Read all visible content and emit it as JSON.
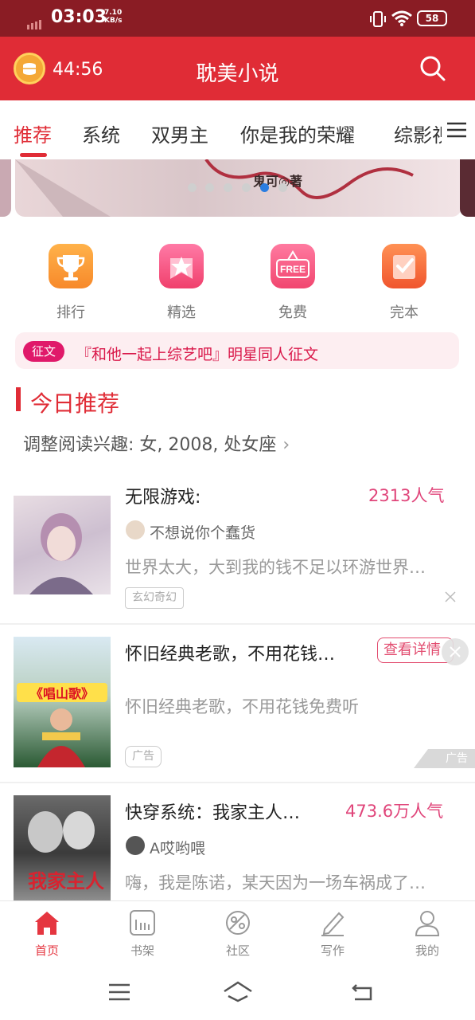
{
  "status_bar": {
    "time": "03:03",
    "speed_value": "7.10",
    "speed_unit": "KB/s",
    "battery": "58"
  },
  "header": {
    "timer": "44:56",
    "title": "耽美小说"
  },
  "tabs": [
    {
      "label": "推荐",
      "active": true
    },
    {
      "label": "系统"
    },
    {
      "label": "双男主"
    },
    {
      "label": "你是我的荣耀"
    },
    {
      "label": "综影视"
    }
  ],
  "banner": {
    "author_text": "鬼可◎著",
    "dots": 6,
    "active_dot": 4
  },
  "quick_links": [
    {
      "label": "排行",
      "icon": "trophy-icon",
      "color": "#f9982f"
    },
    {
      "label": "精选",
      "icon": "star-icon",
      "color": "#f55483"
    },
    {
      "label": "免费",
      "icon": "free-icon",
      "color": "#f4577f",
      "icon_text": "FREE"
    },
    {
      "label": "完本",
      "icon": "check-book-icon",
      "color": "#f76b3d"
    }
  ],
  "notice": {
    "tag": "征文",
    "text": "『和他一起上综艺吧』明星同人征文"
  },
  "section": {
    "title": "今日推荐",
    "interest": "调整阅读兴趣: 女, 2008, 处女座"
  },
  "feed": [
    {
      "title": "无限游戏:",
      "popularity": "2313人气",
      "author": "不想说你个蠢货",
      "description": "世界太大，大到我的钱不足以环游世界…",
      "tag": "玄幻奇幻"
    },
    {
      "title": "怀旧经典老歌，不用花钱…",
      "cta": "查看详情",
      "description": "怀旧经典老歌，不用花钱免费听",
      "tag": "广告",
      "ad_mark": "广告",
      "cover_text": "《唱山歌》"
    },
    {
      "title": "快穿系统：我家主人…",
      "popularity": "473.6万人气",
      "author": "A哎哟喂",
      "description": "嗨，我是陈诺，某天因为一场车祸成了…",
      "cover_text": "我家主人"
    }
  ],
  "bottom_nav": [
    {
      "label": "首页",
      "icon": "home-icon",
      "active": true
    },
    {
      "label": "书架",
      "icon": "bookshelf-icon"
    },
    {
      "label": "社区",
      "icon": "community-icon"
    },
    {
      "label": "写作",
      "icon": "pen-icon"
    },
    {
      "label": "我的",
      "icon": "user-icon"
    }
  ],
  "colors": {
    "brand": "#e02c36",
    "status_bar": "#8a1c24",
    "popularity": "#e0457a",
    "active_dot": "#2a7de1"
  }
}
